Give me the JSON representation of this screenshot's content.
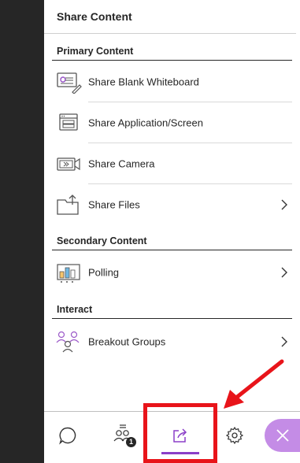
{
  "panel": {
    "title": "Share Content"
  },
  "sections": {
    "primary": {
      "header": "Primary Content",
      "items": [
        {
          "label": "Share Blank Whiteboard",
          "icon": "whiteboard-icon",
          "has_chevron": false
        },
        {
          "label": "Share Application/Screen",
          "icon": "screen-share-icon",
          "has_chevron": false
        },
        {
          "label": "Share Camera",
          "icon": "camera-icon",
          "has_chevron": false
        },
        {
          "label": "Share Files",
          "icon": "files-icon",
          "has_chevron": true
        }
      ]
    },
    "secondary": {
      "header": "Secondary Content",
      "items": [
        {
          "label": "Polling",
          "icon": "polling-icon",
          "has_chevron": true
        }
      ]
    },
    "interact": {
      "header": "Interact",
      "items": [
        {
          "label": "Breakout Groups",
          "icon": "breakout-groups-icon",
          "has_chevron": true
        }
      ]
    }
  },
  "bottom_bar": {
    "tabs": [
      {
        "name": "chat",
        "icon": "chat-icon"
      },
      {
        "name": "attendees",
        "icon": "attendees-icon",
        "badge": "1"
      },
      {
        "name": "share-content",
        "icon": "share-content-icon",
        "active": true
      },
      {
        "name": "settings",
        "icon": "gear-icon"
      },
      {
        "name": "close",
        "icon": "close-icon"
      }
    ]
  },
  "colors": {
    "accent": "#8b3fc8",
    "close_button": "#c48ce6",
    "annotation_red": "#e8141a",
    "dark_sidebar": "#262626"
  }
}
